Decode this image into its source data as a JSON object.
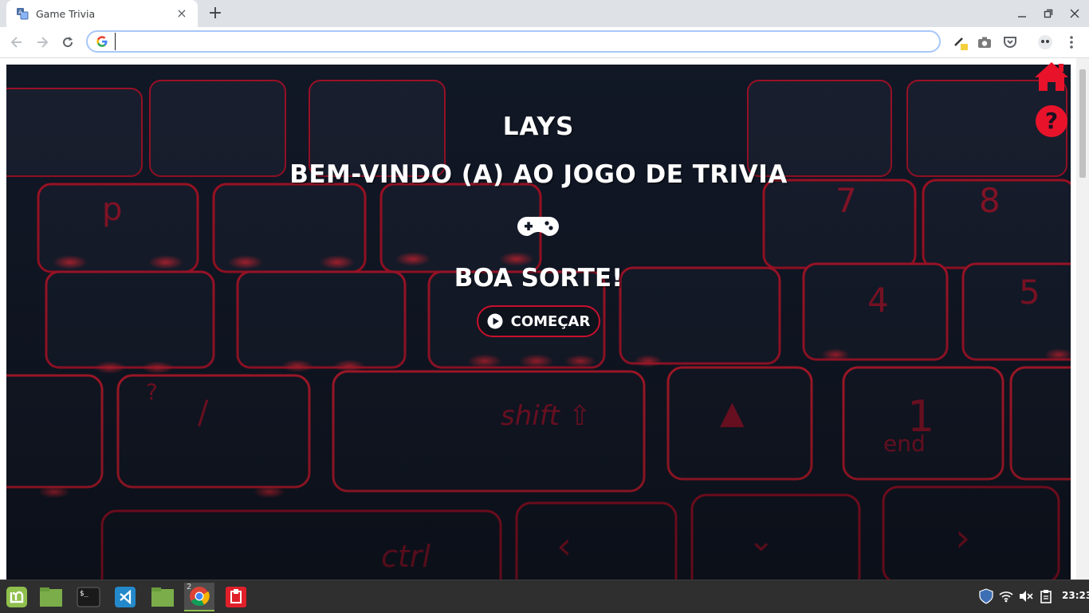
{
  "browser": {
    "tab_title": "Game Trivia",
    "tab_close": "×",
    "new_tab": "+",
    "omnibox_value": "",
    "window_controls": [
      "minimize-icon",
      "restore-icon",
      "close-icon"
    ]
  },
  "game": {
    "player_name": "LAYS",
    "welcome_title": "BEM-VINDO (A) AO JOGO DE TRIVIA",
    "controller_icon": "gamepad-icon",
    "good_luck": "BOA SORTE!",
    "start_label": "COMEÇAR",
    "accent_color": "#e8132b",
    "corner_icons": [
      "home-icon",
      "help-icon"
    ]
  },
  "taskbar": {
    "apps": [
      "mint-menu-icon",
      "files-icon",
      "terminal-icon",
      "vscode-icon",
      "folder-icon",
      "chrome-icon",
      "anydesk-icon"
    ],
    "chrome_window_count": "2",
    "tray_icons": [
      "shield-icon",
      "wifi-icon",
      "volume-icon",
      "clipboard-icon"
    ],
    "clock": "23:23"
  }
}
